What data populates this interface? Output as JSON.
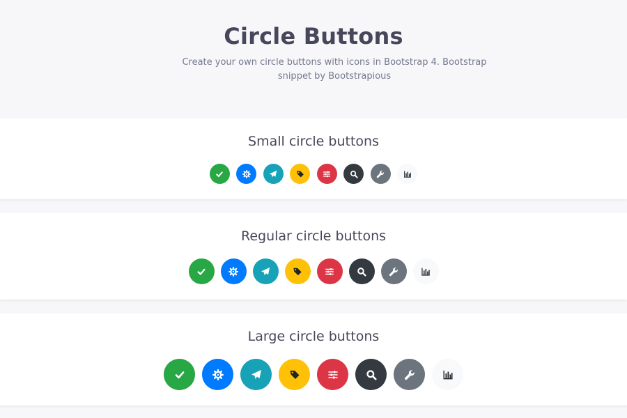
{
  "header": {
    "title": "Circle Buttons",
    "subtitle": "Create your own circle buttons with icons in Bootstrap 4. Bootstrap snippet by Bootstrapious"
  },
  "sections": [
    {
      "title": "Small circle buttons"
    },
    {
      "title": "Regular circle buttons"
    },
    {
      "title": "Large circle buttons"
    }
  ],
  "buttons": [
    {
      "icon": "check-icon",
      "color": "#28a745",
      "variant": "success"
    },
    {
      "icon": "cog-icon",
      "color": "#007bff",
      "variant": "primary"
    },
    {
      "icon": "paper-plane-icon",
      "color": "#17a2b8",
      "variant": "info"
    },
    {
      "icon": "tags-icon",
      "color": "#ffc107",
      "variant": "warning"
    },
    {
      "icon": "sliders-icon",
      "color": "#dc3545",
      "variant": "danger"
    },
    {
      "icon": "search-icon",
      "color": "#343a40",
      "variant": "dark"
    },
    {
      "icon": "wrench-icon",
      "color": "#6c757d",
      "variant": "secondary"
    },
    {
      "icon": "bar-chart-icon",
      "color": "#f8f9fa",
      "variant": "light"
    }
  ]
}
